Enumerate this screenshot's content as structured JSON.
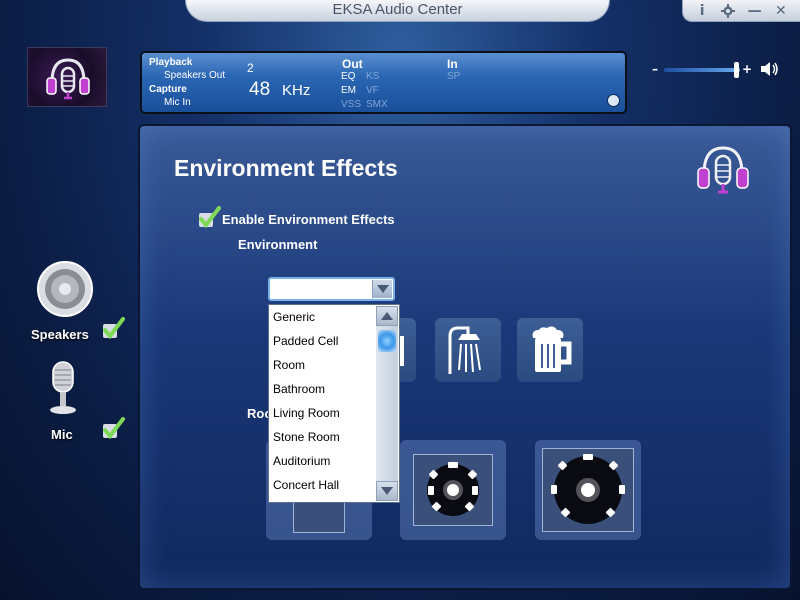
{
  "window": {
    "title": "EKSA Audio Center",
    "controls": {
      "info": "i",
      "minimize": "—",
      "close": "✕"
    }
  },
  "status": {
    "playback_label": "Playback",
    "playback_device": "Speakers Out",
    "capture_label": "Capture",
    "capture_device": "Mic In",
    "channels": "2",
    "sample_rate": "48",
    "sample_unit": "KHz",
    "out_label": "Out",
    "in_label": "In",
    "out_items": [
      "EQ",
      "KS",
      "EM",
      "VF",
      "VSS",
      "SMX"
    ],
    "in_items": [
      "SP"
    ]
  },
  "volume": {
    "minus": "–",
    "plus": "+",
    "level": 0.93
  },
  "sidebar": {
    "speakers_label": "Speakers",
    "mic_label": "Mic"
  },
  "main": {
    "title": "Environment Effects",
    "enable_label": "Enable Environment Effects",
    "enable_checked": true,
    "environment_label": "Environment",
    "room_label": "Roo",
    "dropdown_value": "",
    "dropdown_options": [
      "Generic",
      "Padded Cell",
      "Room",
      "Bathroom",
      "Living Room",
      "Stone Room",
      "Auditorium",
      "Concert Hall"
    ]
  },
  "colors": {
    "accent": "#3a96e8",
    "check": "#7ed957",
    "panel": "#1a3878",
    "headset": "#c040d0"
  }
}
